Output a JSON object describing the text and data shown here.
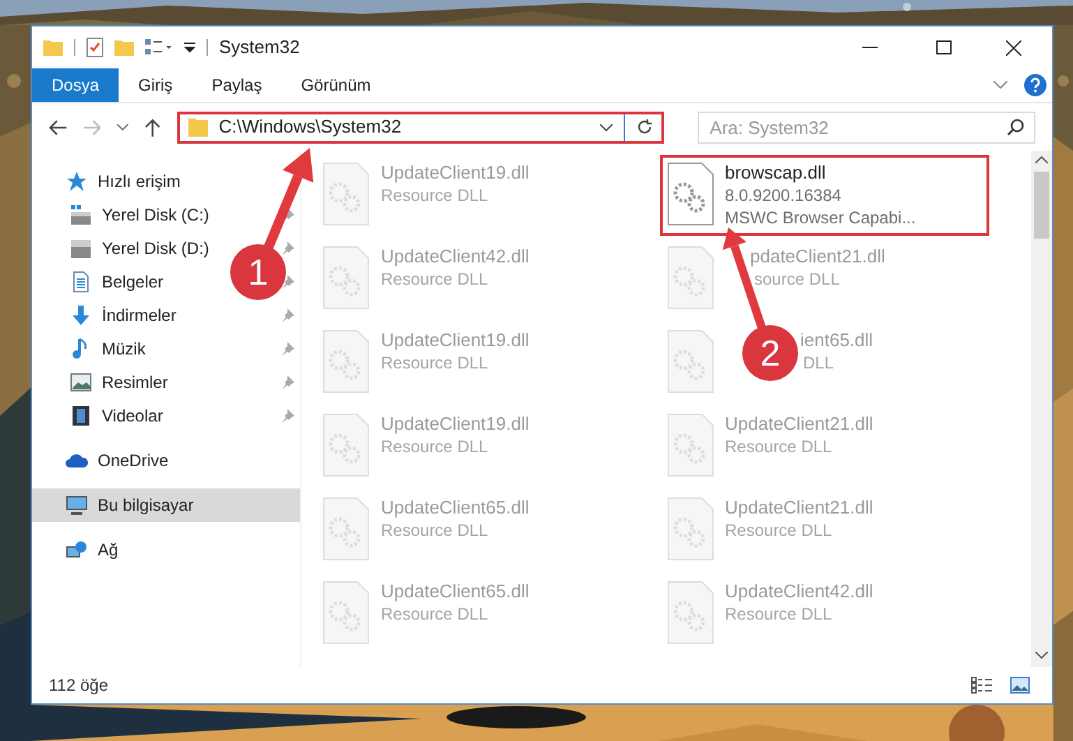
{
  "window": {
    "title": "System32"
  },
  "ribbon_tabs": [
    {
      "label": "Dosya",
      "selected": true
    },
    {
      "label": "Giriş",
      "selected": false
    },
    {
      "label": "Paylaş",
      "selected": false
    },
    {
      "label": "Görünüm",
      "selected": false
    }
  ],
  "address_bar": {
    "path": "C:\\Windows\\System32"
  },
  "search": {
    "placeholder": "Ara: System32"
  },
  "sidebar": {
    "items": [
      {
        "label": "Hızlı erişim",
        "kind": "star",
        "selected": false,
        "children": [
          {
            "label": "Yerel Disk (C:)",
            "kind": "system-drive",
            "pinned": true
          },
          {
            "label": "Yerel Disk (D:)",
            "kind": "drive",
            "pinned": true
          },
          {
            "label": "Belgeler",
            "kind": "documents",
            "pinned": true
          },
          {
            "label": "İndirmeler",
            "kind": "downloads",
            "pinned": true
          },
          {
            "label": "Müzik",
            "kind": "music",
            "pinned": true
          },
          {
            "label": "Resimler",
            "kind": "pictures",
            "pinned": true
          },
          {
            "label": "Videolar",
            "kind": "videos",
            "pinned": true
          }
        ]
      },
      {
        "label": "OneDrive",
        "kind": "cloud",
        "selected": false
      },
      {
        "label": "Bu bilgisayar",
        "kind": "computer",
        "selected": true
      },
      {
        "label": "Ağ",
        "kind": "network",
        "selected": false
      }
    ]
  },
  "files": [
    {
      "name": "UpdateClient19.dll",
      "type": "Resource DLL",
      "highlighted": false
    },
    {
      "name": "browscap.dll",
      "version": "8.0.9200.16384",
      "type": "MSWC Browser Capabi...",
      "highlighted": true
    },
    {
      "name": "UpdateClient42.dll",
      "type": "Resource DLL",
      "highlighted": false
    },
    {
      "name": "pdateClient21.dll",
      "type": "source DLL",
      "highlighted": false,
      "kind": "under-arrow"
    },
    {
      "name": "UpdateClient19.dll",
      "type": "Resource DLL",
      "highlighted": false
    },
    {
      "name": "ient65.dll",
      "type": "DLL",
      "highlighted": false,
      "kind": "under-marker"
    },
    {
      "name": "UpdateClient19.dll",
      "type": "Resource DLL",
      "highlighted": false
    },
    {
      "name": "UpdateClient21.dll",
      "type": "Resource DLL",
      "highlighted": false
    },
    {
      "name": "UpdateClient65.dll",
      "type": "Resource DLL",
      "highlighted": false
    },
    {
      "name": "UpdateClient21.dll",
      "type": "Resource DLL",
      "highlighted": false
    },
    {
      "name": "UpdateClient65.dll",
      "type": "Resource DLL",
      "highlighted": false
    },
    {
      "name": "UpdateClient42.dll",
      "type": "Resource DLL",
      "highlighted": false
    }
  ],
  "status_bar": {
    "count": "112 öğe"
  },
  "annotations": [
    {
      "label": "1"
    },
    {
      "label": "2"
    }
  ]
}
